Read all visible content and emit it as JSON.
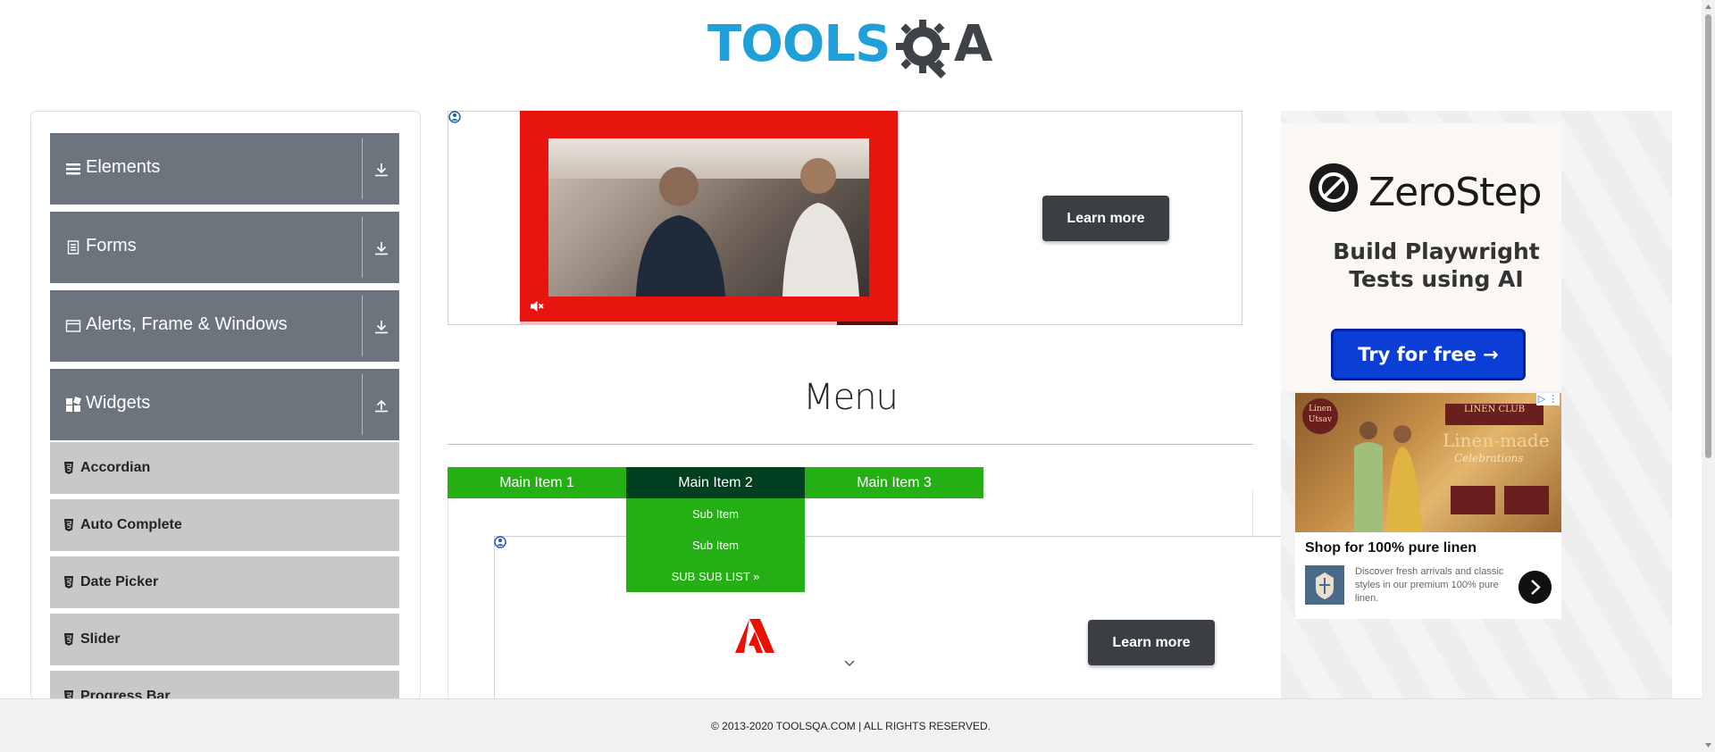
{
  "header": {
    "logo_text": "TOOLS",
    "logo_suffix": "A",
    "logo_gear_letter": "Q"
  },
  "sidebar": {
    "groups": [
      {
        "label": "Elements",
        "icon": "hamburger-icon",
        "arrow": "download-arrow-icon"
      },
      {
        "label": "Forms",
        "icon": "document-icon",
        "arrow": "download-arrow-icon"
      },
      {
        "label": "Alerts, Frame & Windows",
        "icon": "window-icon",
        "arrow": "download-arrow-icon"
      },
      {
        "label": "Widgets",
        "icon": "widgets-icon",
        "arrow": "upload-arrow-icon"
      }
    ],
    "widget_items": [
      "Accordian",
      "Auto Complete",
      "Date Picker",
      "Slider",
      "Progress Bar"
    ]
  },
  "ads": {
    "top_learn_more": "Learn more",
    "bottom_learn_more": "Learn more"
  },
  "main": {
    "title": "Menu",
    "nav_items": [
      "Main Item 1",
      "Main Item 2",
      "Main Item 3"
    ],
    "active_nav": "Main Item 2",
    "dropdown_items": [
      "Sub Item",
      "Sub Item",
      "SUB SUB LIST »"
    ]
  },
  "right_ad": {
    "brand": "ZeroStep",
    "headline": "Build Playwright Tests using AI",
    "cta": "Try for free →",
    "linen_badge": "Linen Utsav",
    "linen_brand": "LINEN CLUB",
    "linen_tagline": "Linen-made",
    "linen_tagline2": "Celebrations",
    "linen_title": "Shop for 100% pure linen",
    "linen_desc": "Discover fresh arrivals and classic styles in our premium 100% pure linen."
  },
  "footer": {
    "text": "© 2013-2020 TOOLSQA.COM | ALL RIGHTS RESERVED."
  },
  "colors": {
    "sidebar_group": "#6c757d",
    "sidebar_item": "#c8c8c8",
    "nav_green": "#24af15",
    "nav_active": "#003f20",
    "logo_blue": "#1fa0db",
    "cta_blue": "#0a3ed4"
  }
}
